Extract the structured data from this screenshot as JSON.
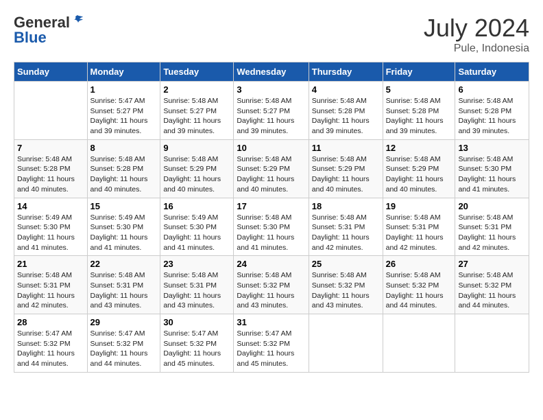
{
  "header": {
    "logo_line1": "General",
    "logo_line2": "Blue",
    "month_year": "July 2024",
    "location": "Pule, Indonesia"
  },
  "days_of_week": [
    "Sunday",
    "Monday",
    "Tuesday",
    "Wednesday",
    "Thursday",
    "Friday",
    "Saturday"
  ],
  "weeks": [
    [
      {
        "num": "",
        "info": ""
      },
      {
        "num": "1",
        "info": "Sunrise: 5:47 AM\nSunset: 5:27 PM\nDaylight: 11 hours\nand 39 minutes."
      },
      {
        "num": "2",
        "info": "Sunrise: 5:48 AM\nSunset: 5:27 PM\nDaylight: 11 hours\nand 39 minutes."
      },
      {
        "num": "3",
        "info": "Sunrise: 5:48 AM\nSunset: 5:27 PM\nDaylight: 11 hours\nand 39 minutes."
      },
      {
        "num": "4",
        "info": "Sunrise: 5:48 AM\nSunset: 5:28 PM\nDaylight: 11 hours\nand 39 minutes."
      },
      {
        "num": "5",
        "info": "Sunrise: 5:48 AM\nSunset: 5:28 PM\nDaylight: 11 hours\nand 39 minutes."
      },
      {
        "num": "6",
        "info": "Sunrise: 5:48 AM\nSunset: 5:28 PM\nDaylight: 11 hours\nand 39 minutes."
      }
    ],
    [
      {
        "num": "7",
        "info": "Sunrise: 5:48 AM\nSunset: 5:28 PM\nDaylight: 11 hours\nand 40 minutes."
      },
      {
        "num": "8",
        "info": "Sunrise: 5:48 AM\nSunset: 5:28 PM\nDaylight: 11 hours\nand 40 minutes."
      },
      {
        "num": "9",
        "info": "Sunrise: 5:48 AM\nSunset: 5:29 PM\nDaylight: 11 hours\nand 40 minutes."
      },
      {
        "num": "10",
        "info": "Sunrise: 5:48 AM\nSunset: 5:29 PM\nDaylight: 11 hours\nand 40 minutes."
      },
      {
        "num": "11",
        "info": "Sunrise: 5:48 AM\nSunset: 5:29 PM\nDaylight: 11 hours\nand 40 minutes."
      },
      {
        "num": "12",
        "info": "Sunrise: 5:48 AM\nSunset: 5:29 PM\nDaylight: 11 hours\nand 40 minutes."
      },
      {
        "num": "13",
        "info": "Sunrise: 5:48 AM\nSunset: 5:30 PM\nDaylight: 11 hours\nand 41 minutes."
      }
    ],
    [
      {
        "num": "14",
        "info": "Sunrise: 5:49 AM\nSunset: 5:30 PM\nDaylight: 11 hours\nand 41 minutes."
      },
      {
        "num": "15",
        "info": "Sunrise: 5:49 AM\nSunset: 5:30 PM\nDaylight: 11 hours\nand 41 minutes."
      },
      {
        "num": "16",
        "info": "Sunrise: 5:49 AM\nSunset: 5:30 PM\nDaylight: 11 hours\nand 41 minutes."
      },
      {
        "num": "17",
        "info": "Sunrise: 5:48 AM\nSunset: 5:30 PM\nDaylight: 11 hours\nand 41 minutes."
      },
      {
        "num": "18",
        "info": "Sunrise: 5:48 AM\nSunset: 5:31 PM\nDaylight: 11 hours\nand 42 minutes."
      },
      {
        "num": "19",
        "info": "Sunrise: 5:48 AM\nSunset: 5:31 PM\nDaylight: 11 hours\nand 42 minutes."
      },
      {
        "num": "20",
        "info": "Sunrise: 5:48 AM\nSunset: 5:31 PM\nDaylight: 11 hours\nand 42 minutes."
      }
    ],
    [
      {
        "num": "21",
        "info": "Sunrise: 5:48 AM\nSunset: 5:31 PM\nDaylight: 11 hours\nand 42 minutes."
      },
      {
        "num": "22",
        "info": "Sunrise: 5:48 AM\nSunset: 5:31 PM\nDaylight: 11 hours\nand 43 minutes."
      },
      {
        "num": "23",
        "info": "Sunrise: 5:48 AM\nSunset: 5:31 PM\nDaylight: 11 hours\nand 43 minutes."
      },
      {
        "num": "24",
        "info": "Sunrise: 5:48 AM\nSunset: 5:32 PM\nDaylight: 11 hours\nand 43 minutes."
      },
      {
        "num": "25",
        "info": "Sunrise: 5:48 AM\nSunset: 5:32 PM\nDaylight: 11 hours\nand 43 minutes."
      },
      {
        "num": "26",
        "info": "Sunrise: 5:48 AM\nSunset: 5:32 PM\nDaylight: 11 hours\nand 44 minutes."
      },
      {
        "num": "27",
        "info": "Sunrise: 5:48 AM\nSunset: 5:32 PM\nDaylight: 11 hours\nand 44 minutes."
      }
    ],
    [
      {
        "num": "28",
        "info": "Sunrise: 5:47 AM\nSunset: 5:32 PM\nDaylight: 11 hours\nand 44 minutes."
      },
      {
        "num": "29",
        "info": "Sunrise: 5:47 AM\nSunset: 5:32 PM\nDaylight: 11 hours\nand 44 minutes."
      },
      {
        "num": "30",
        "info": "Sunrise: 5:47 AM\nSunset: 5:32 PM\nDaylight: 11 hours\nand 45 minutes."
      },
      {
        "num": "31",
        "info": "Sunrise: 5:47 AM\nSunset: 5:32 PM\nDaylight: 11 hours\nand 45 minutes."
      },
      {
        "num": "",
        "info": ""
      },
      {
        "num": "",
        "info": ""
      },
      {
        "num": "",
        "info": ""
      }
    ]
  ]
}
